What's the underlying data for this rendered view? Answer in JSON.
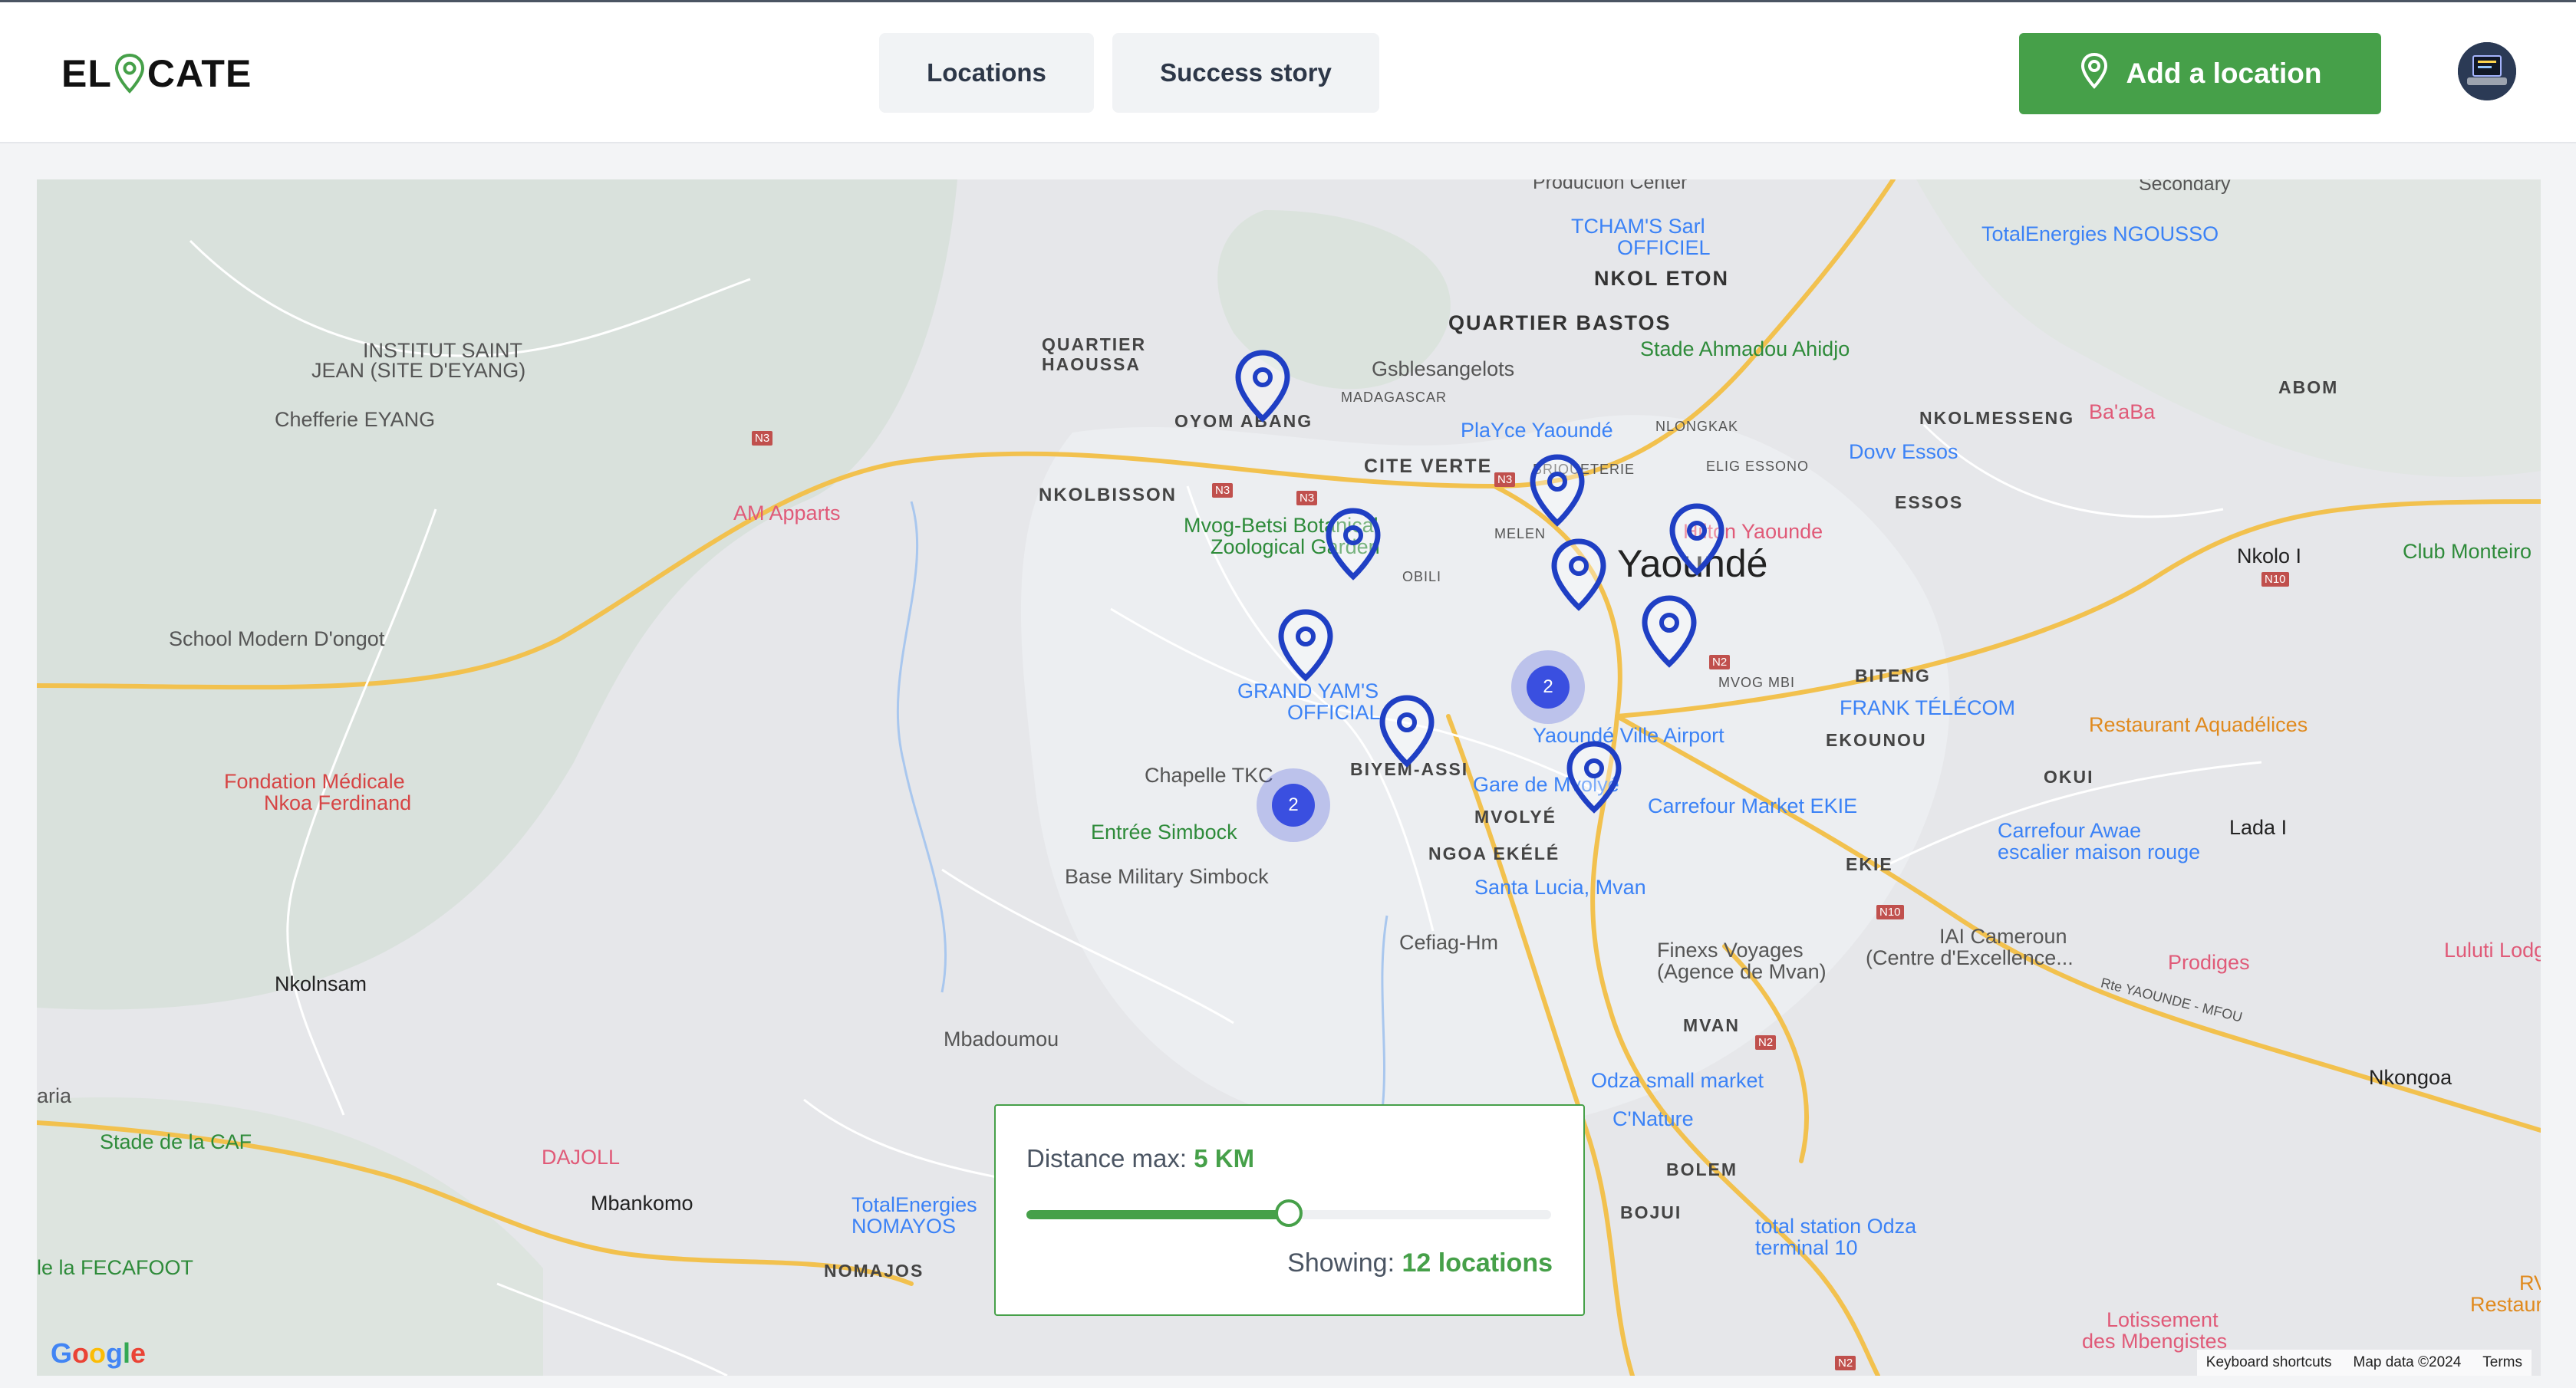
{
  "brand": {
    "part1": "EL",
    "part2": "CATE",
    "accent": "#46a049"
  },
  "nav": {
    "locations": "Locations",
    "success_story": "Success story"
  },
  "actions": {
    "add_location": "Add a location"
  },
  "filter": {
    "distance_label": "Distance max:",
    "distance_value": "5 KM",
    "slider_fraction": 0.5,
    "showing_label": "Showing:",
    "showing_value": "12 locations"
  },
  "map": {
    "google": "Google",
    "footer": {
      "shortcuts": "Keyboard shortcuts",
      "data": "Map data ©2024",
      "terms": "Terms"
    },
    "city": "Yaoundé",
    "clusters": [
      "2",
      "2"
    ],
    "labels": [
      "Production Center",
      "Secondary",
      "TCHAM'S Sarl",
      "OFFICIEL",
      "NKOL ETON",
      "TotalEnergies NGOUSSO",
      "QUARTIER",
      "HAOUSSA",
      "QUARTIER BASTOS",
      "Stade Ahmadou Ahidjo",
      "INSTITUT SAINT",
      "JEAN (SITE D'EYANG)",
      "Gsblesangelots",
      "MADAGASCAR",
      "OYOM ABANG",
      "NLONGKAK",
      "ABOM",
      "NKOLMESSENG",
      "Ba'aBa",
      "Chefferie EYANG",
      "PlaYce Yaoundé",
      "BRIQUETERIE",
      "ELIG ESSONO",
      "Dovv Essos",
      "CITE VERTE",
      "NKOLBISSON",
      "AM Apparts",
      "ESSOS",
      "Mvog-Betsi Botanical",
      "Zoological Garden",
      "MELEN",
      "Hilton Yaounde",
      "Nkolo I",
      "Club Monteiro",
      "OBILI",
      "School Modern D'ongot",
      "BITENG",
      "GRAND YAM'S",
      "OFFICIAL",
      "MVOG MBI",
      "FRANK TÉLÉCOM",
      "Restaurant Aquadélices",
      "Yaoundé Ville Airport",
      "EKOUNOU",
      "Chapelle TKC",
      "BIYEM-ASSI",
      "OKUI",
      "Fondation Médicale",
      "Nkoa Ferdinand",
      "Gare de Mvolyé",
      "Carrefour Market EKIE",
      "MVOLYÉ",
      "Lada I",
      "Entrée Simbock",
      "Carrefour Awae",
      "escalier maison rouge",
      "NGOA EKÉLÉ",
      "Base Military Simbock",
      "EKIE",
      "Santa Lucia, Mvan",
      "Cefiag-Hm",
      "IAI Cameroun",
      "(Centre d'Excellence...",
      "Finexs Voyages",
      "(Agence de Mvan)",
      "Luluti Lodge",
      "Nkolnsam",
      "Prodiges",
      "Rte YAOUNDE - MFOU",
      "MVAN",
      "Mbadoumou",
      "Nkongoa",
      "aria",
      "Odza small market",
      "C'Nature",
      "Stade de la CAF",
      "DAJOLL",
      "BOLEM",
      "Mbankomo",
      "TotalEnergies",
      "NOMAYOS",
      "BOJUI",
      "total station Odza",
      "terminal 10",
      "le la FECAFOOT",
      "NOMAJOS",
      "RV",
      "Restaurant",
      "Lotissement",
      "des Mbengistes"
    ],
    "road_shields": [
      "N3",
      "N3",
      "N3",
      "N3",
      "N2",
      "N10",
      "N10",
      "N2",
      "N2"
    ]
  }
}
